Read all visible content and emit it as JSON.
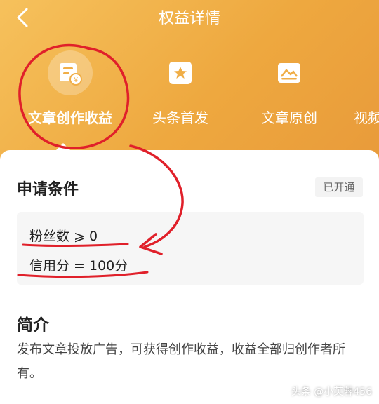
{
  "header": {
    "back_icon": "chevron-left-icon",
    "title": "权益详情"
  },
  "tabs": [
    {
      "label": "文章创作收益",
      "icon": "article-income-icon",
      "active": true
    },
    {
      "label": "头条首发",
      "icon": "star-doc-icon",
      "active": false
    },
    {
      "label": "文章原创",
      "icon": "image-doc-icon",
      "active": false
    },
    {
      "label": "视频",
      "icon": "",
      "active": false
    }
  ],
  "conditions": {
    "title": "申请条件",
    "status_badge": "已开通",
    "items": [
      "粉丝数 ⩾ 0",
      "信用分 = 100分"
    ]
  },
  "intro": {
    "title": "简介",
    "text": "发布文章投放广告，可获得创作收益，收益全部归创作者所有。"
  },
  "watermark": "头条 @小芙蓉456",
  "colors": {
    "header_gradient_start": "#f6c15c",
    "header_gradient_end": "#e89a3a",
    "annotation_red": "#e0202a"
  }
}
